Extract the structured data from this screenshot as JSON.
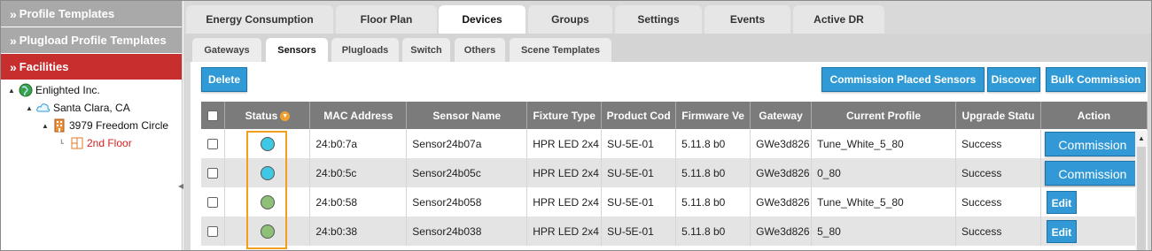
{
  "sidebar": {
    "sections": [
      {
        "label": "Profile Templates",
        "active": false
      },
      {
        "label": "Plugload Profile Templates",
        "active": false
      },
      {
        "label": "Facilities",
        "active": true
      }
    ],
    "tree": [
      {
        "label": "Enlighted Inc."
      },
      {
        "label": "Santa Clara, CA"
      },
      {
        "label": "3979 Freedom Circle"
      },
      {
        "label": "2nd Floor",
        "selected": true
      }
    ]
  },
  "top_tabs": [
    "Energy Consumption",
    "Floor Plan",
    "Devices",
    "Groups",
    "Settings",
    "Events",
    "Active DR"
  ],
  "active_top_tab": "Devices",
  "sub_tabs": [
    "Gateways",
    "Sensors",
    "Plugloads",
    "Switch",
    "Others",
    "Scene Templates"
  ],
  "active_sub_tab": "Sensors",
  "toolbar": {
    "delete": "Delete",
    "commission_placed": "Commission Placed Sensors",
    "discover": "Discover",
    "bulk_commission": "Bulk Commission"
  },
  "table": {
    "columns": [
      "Status",
      "MAC Address",
      "Sensor Name",
      "Fixture Type",
      "Product Cod",
      "Firmware Ve",
      "Gateway",
      "Current Profile",
      "Upgrade Statu",
      "Action"
    ],
    "rows": [
      {
        "status_color": "#3fc8e4",
        "mac": "24:b0:7a",
        "name": "Sensor24b07a",
        "fixture": "HPR LED 2x4",
        "product": "SU-5E-01",
        "firmware": "5.11.8 b0",
        "gateway": "GWe3d826",
        "profile": "Tune_White_5_80",
        "upgrade": "Success",
        "action": "Commission"
      },
      {
        "status_color": "#3fc8e4",
        "mac": "24:b0:5c",
        "name": "Sensor24b05c",
        "fixture": "HPR LED 2x4",
        "product": "SU-5E-01",
        "firmware": "5.11.8 b0",
        "gateway": "GWe3d826",
        "profile": "0_80",
        "upgrade": "Success",
        "action": "Commission"
      },
      {
        "status_color": "#8fc078",
        "mac": "24:b0:58",
        "name": "Sensor24b058",
        "fixture": "HPR LED 2x4",
        "product": "SU-5E-01",
        "firmware": "5.11.8 b0",
        "gateway": "GWe3d826",
        "profile": "Tune_White_5_80",
        "upgrade": "Success",
        "action": "Edit"
      },
      {
        "status_color": "#8fc078",
        "mac": "24:b0:38",
        "name": "Sensor24b038",
        "fixture": "HPR LED 2x4",
        "product": "SU-5E-01",
        "firmware": "5.11.8 b0",
        "gateway": "GWe3d826",
        "profile": "5_80",
        "upgrade": "Success",
        "action": "Edit"
      }
    ]
  },
  "colors": {
    "accent": "#2f9ad6",
    "active_section": "#c72e2e",
    "highlight": "#f0a01e"
  }
}
